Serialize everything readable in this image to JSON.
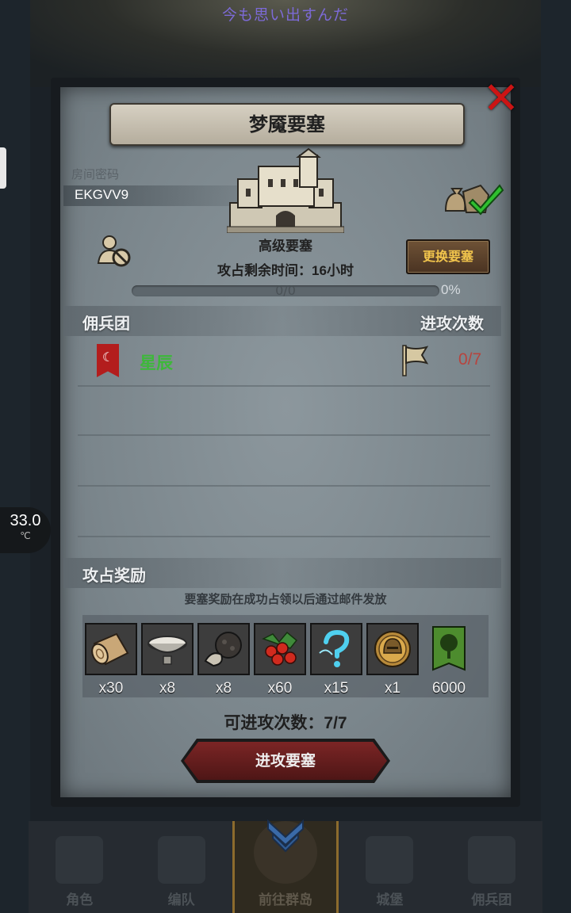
{
  "banner_text": "今も思い出すんだ",
  "temperature": {
    "value": "33.0",
    "unit": "℃"
  },
  "panel": {
    "title": "梦魇要塞",
    "room_label": "房间密码",
    "room_code": "EKGVV9",
    "fortress_name": "高级要塞",
    "change_button": "更换要塞",
    "time_label": "攻占剩余时间：",
    "time_value": "16小时",
    "progress_text": "0/0",
    "progress_percent": "0%",
    "progress_fraction": 0,
    "mercenary_header": "佣兵团",
    "attacks_header": "进攻次数",
    "guild": {
      "icon_text": "☾",
      "name": "星辰",
      "count": "0/7"
    },
    "rewards_header": "攻占奖励",
    "rewards_note": "要塞奖励在成功占领以后通过邮件发放",
    "rewards": [
      {
        "name": "wood-log-icon",
        "qty": "x30"
      },
      {
        "name": "milk-bowl-icon",
        "qty": "x8"
      },
      {
        "name": "truffle-icon",
        "qty": "x8"
      },
      {
        "name": "berries-icon",
        "qty": "x60"
      },
      {
        "name": "mystery-icon",
        "qty": "x15"
      },
      {
        "name": "helmet-coin-icon",
        "qty": "x1"
      },
      {
        "name": "tree-banner-icon",
        "qty": "6000"
      }
    ],
    "attempts_label": "可进攻次数：",
    "attempts_value": "7/7",
    "attack_button": "进攻要塞"
  },
  "nav": [
    {
      "label": "角色"
    },
    {
      "label": "编队"
    },
    {
      "label": "前往群岛"
    },
    {
      "label": "城堡"
    },
    {
      "label": "佣兵团"
    }
  ],
  "colors": {
    "accent_gold": "#f1c44c",
    "guild_green": "#3db83a",
    "count_red": "#b7443e",
    "close_red": "#cc1414"
  }
}
